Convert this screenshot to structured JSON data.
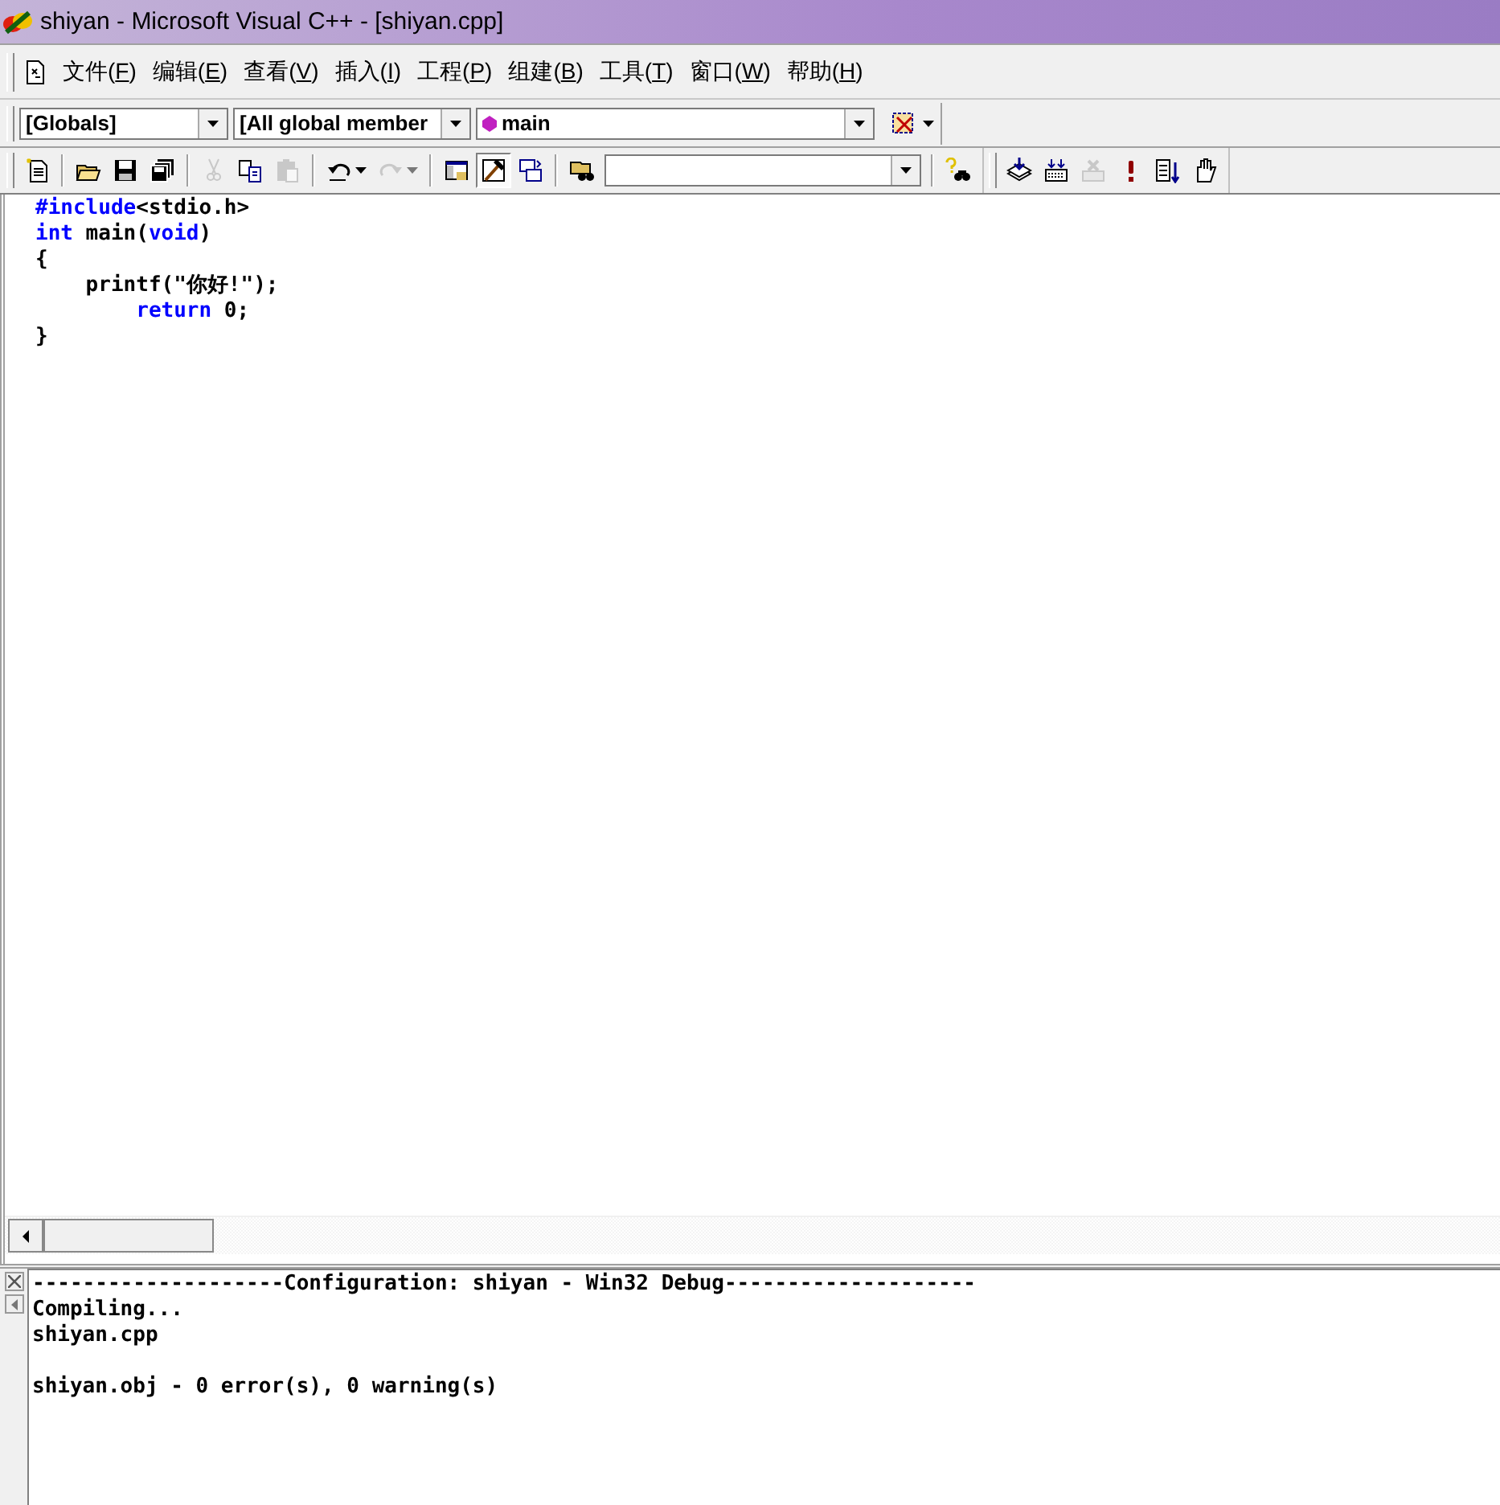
{
  "window": {
    "title": "shiyan - Microsoft Visual C++ - [shiyan.cpp]"
  },
  "menu": [
    {
      "label": "文件(F)"
    },
    {
      "label": "编辑(E)"
    },
    {
      "label": "查看(V)"
    },
    {
      "label": "插入(I)"
    },
    {
      "label": "工程(P)"
    },
    {
      "label": "组建(B)"
    },
    {
      "label": "工具(T)"
    },
    {
      "label": "窗口(W)"
    },
    {
      "label": "帮助(H)"
    }
  ],
  "wizard_bar": {
    "combos": [
      {
        "kind": "plain",
        "value": "[Globals]"
      },
      {
        "kind": "plain",
        "value": "[All global member"
      },
      {
        "kind": "function",
        "value": "main"
      }
    ]
  },
  "toolbar": {
    "groups": [
      [
        {
          "kind": "new",
          "disabled": false,
          "pressed": false
        }
      ],
      [
        {
          "kind": "open",
          "disabled": false,
          "pressed": false
        },
        {
          "kind": "save",
          "disabled": false,
          "pressed": false
        },
        {
          "kind": "saveall",
          "disabled": false,
          "pressed": false
        }
      ],
      [
        {
          "kind": "cut",
          "disabled": true,
          "pressed": false
        },
        {
          "kind": "copy",
          "disabled": false,
          "pressed": false
        },
        {
          "kind": "paste",
          "disabled": true,
          "pressed": false
        }
      ],
      [
        {
          "kind": "undo",
          "disabled": false,
          "pressed": false
        },
        {
          "kind": "redo",
          "disabled": true,
          "pressed": false
        }
      ],
      [
        {
          "kind": "workspace",
          "disabled": false,
          "pressed": false
        },
        {
          "kind": "output",
          "disabled": false,
          "pressed": true
        },
        {
          "kind": "windows",
          "disabled": false,
          "pressed": false
        }
      ],
      [
        {
          "kind": "findfiles",
          "disabled": false,
          "pressed": false
        }
      ],
      [
        {
          "kind": "find",
          "disabled": false,
          "pressed": false
        }
      ]
    ],
    "build_buttons": [
      {
        "kind": "compile",
        "disabled": false,
        "pressed": false
      },
      {
        "kind": "build",
        "disabled": false,
        "pressed": false
      },
      {
        "kind": "stop",
        "disabled": true,
        "pressed": false
      },
      {
        "kind": "execute",
        "disabled": false,
        "pressed": false
      },
      {
        "kind": "go",
        "disabled": false,
        "pressed": false
      },
      {
        "kind": "breakpoint",
        "disabled": false,
        "pressed": false
      }
    ]
  },
  "editor": {
    "lines": [
      [
        {
          "kind": "keyword",
          "text": "#include"
        },
        {
          "kind": "plain",
          "text": "<stdio.h>"
        }
      ],
      [
        {
          "kind": "keyword",
          "text": "int"
        },
        {
          "kind": "plain",
          "text": " main("
        },
        {
          "kind": "keyword",
          "text": "void"
        },
        {
          "kind": "plain",
          "text": ")"
        }
      ],
      [
        {
          "kind": "plain",
          "text": "{"
        }
      ],
      [
        {
          "kind": "plain",
          "text": "    printf(\"你好!\");"
        }
      ],
      [
        {
          "kind": "keyword",
          "text": "        return"
        },
        {
          "kind": "plain",
          "text": " 0;"
        }
      ],
      [
        {
          "kind": "plain",
          "text": "}"
        }
      ]
    ]
  },
  "output": {
    "blocks": [
      [
        "--------------------Configuration: shiyan - Win32 Debug--------------------",
        "Compiling...",
        "shiyan.cpp"
      ],
      [
        "shiyan.obj - 0 error(s), 0 warning(s)"
      ]
    ]
  }
}
